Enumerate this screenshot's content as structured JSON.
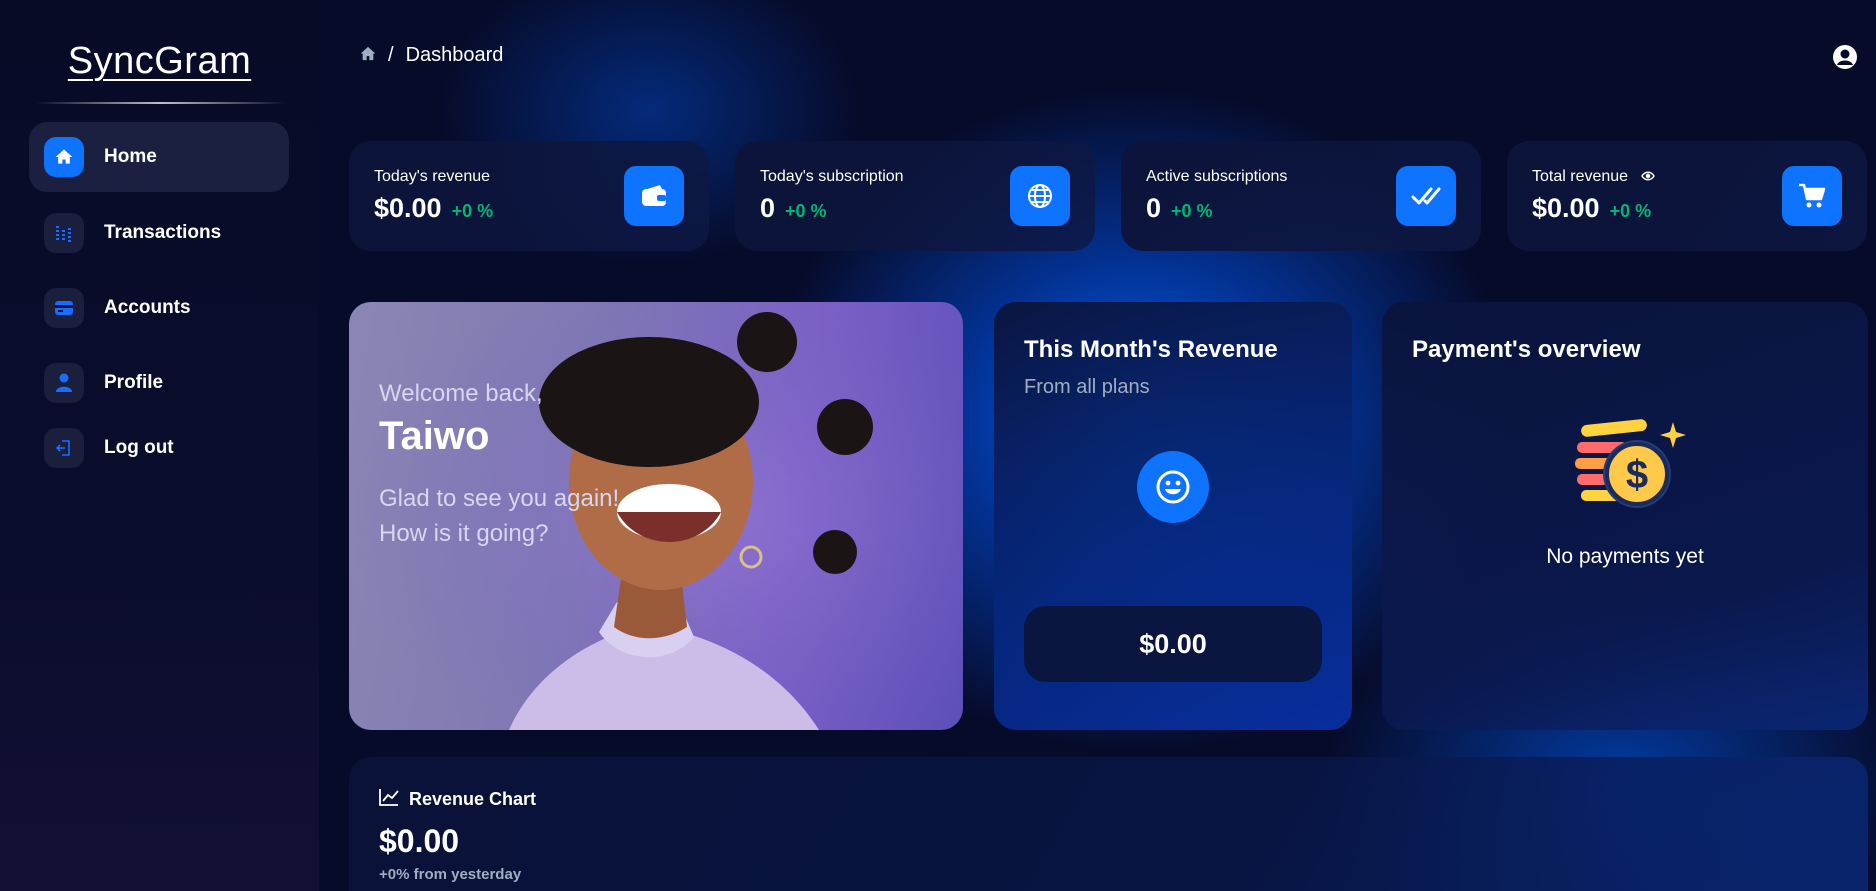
{
  "app": {
    "logo": "SyncGram"
  },
  "sidebar": {
    "items": [
      {
        "label": "Home",
        "icon": "home-icon",
        "active": true
      },
      {
        "label": "Transactions",
        "icon": "chart-bars-icon"
      },
      {
        "label": "Accounts",
        "icon": "card-icon"
      },
      {
        "label": "Profile",
        "icon": "person-icon"
      },
      {
        "label": "Log out",
        "icon": "logout-icon"
      }
    ]
  },
  "header": {
    "breadcrumb_icon": "home-icon",
    "separator": "/",
    "page": "Dashboard",
    "user_icon": "user-circle-icon"
  },
  "stats": [
    {
      "title": "Today's revenue",
      "value": "$0.00",
      "change": "+0 %",
      "icon": "wallet-icon"
    },
    {
      "title": "Today's subscription",
      "value": "0",
      "change": "+0 %",
      "icon": "globe-icon"
    },
    {
      "title": "Active subscriptions",
      "value": "0",
      "change": "+0 %",
      "icon": "double-check-icon"
    },
    {
      "title": "Total revenue",
      "value": "$0.00",
      "change": "+0 %",
      "icon": "cart-icon",
      "title_icon": "eye-icon"
    }
  ],
  "welcome": {
    "greeting": "Welcome back,",
    "name": "Taiwo",
    "line1": "Glad to see you again!",
    "line2": "How is it going?"
  },
  "month_revenue": {
    "title": "This Month's Revenue",
    "subtitle": "From all plans",
    "value": "$0.00",
    "icon": "smile-icon"
  },
  "payments": {
    "title": "Payment's overview",
    "empty_text": "No payments yet",
    "icon": "coin-stack-icon"
  },
  "revenue_chart": {
    "title": "Revenue Chart",
    "value": "$0.00",
    "subtitle": "+0% from yesterday",
    "icon": "line-chart-icon"
  },
  "colors": {
    "accent": "#0e73ff",
    "positive": "#01b574",
    "background": "#060b2a"
  }
}
